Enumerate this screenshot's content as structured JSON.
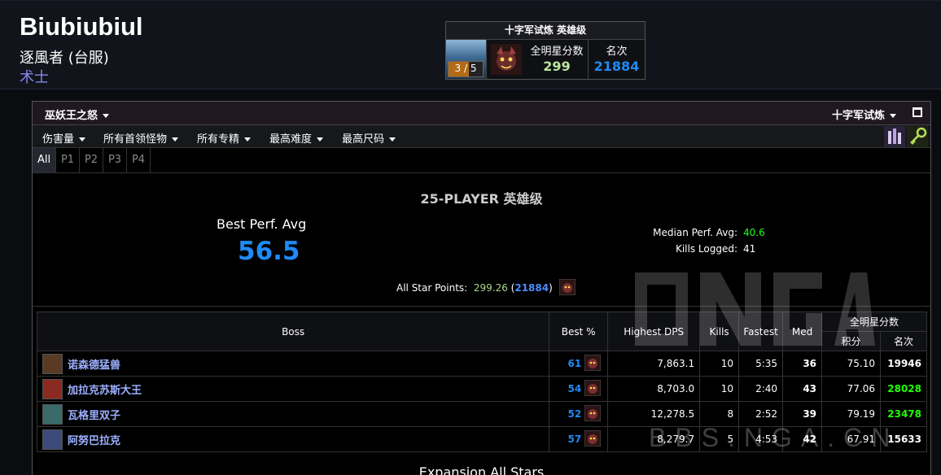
{
  "character": {
    "name": "Biubiubiul",
    "server": "逐風者 (台服)",
    "class": "术士"
  },
  "zone_box": {
    "title": "十字军试炼 英雄级",
    "progress_text": "3 / 5",
    "progress_fraction": 0.6,
    "points_label": "全明星分数",
    "points_value": "299",
    "rank_label": "名次",
    "rank_value": "21884"
  },
  "panel": {
    "zone_dropdown": "巫妖王之怒",
    "partition_dropdown": "十字军试炼",
    "filters": [
      "伤害量",
      "所有首领怪物",
      "所有专精",
      "最高难度",
      "最高尺码"
    ],
    "tabs": [
      "All",
      "P1",
      "P2",
      "P3",
      "P4"
    ],
    "active_tab": "All"
  },
  "summary": {
    "title": "25-PLAYER 英雄级",
    "best_perf_label": "Best Perf. Avg",
    "best_perf_value": "56.5",
    "median_label": "Median Perf. Avg:",
    "median_value": "40.6",
    "kills_label": "Kills Logged:",
    "kills_value": "41",
    "allstar_label": "All Star Points:",
    "allstar_points": "299.26",
    "allstar_rank": "21884"
  },
  "table": {
    "headers": {
      "boss": "Boss",
      "best": "Best %",
      "dps": "Highest DPS",
      "kills": "Kills",
      "fastest": "Fastest",
      "med": "Med",
      "allstar": "全明星分数",
      "points": "积分",
      "rank": "名次"
    },
    "rows": [
      {
        "boss": "诺森德猛兽",
        "best": "61",
        "dps": "7,863.1",
        "kills": "10",
        "fastest": "5:35",
        "med": "36",
        "points": "75.10",
        "rank": "19946"
      },
      {
        "boss": "加拉克苏斯大王",
        "best": "54",
        "dps": "8,703.0",
        "kills": "10",
        "fastest": "2:40",
        "med": "43",
        "points": "77.06",
        "rank": "28028"
      },
      {
        "boss": "瓦格里双子",
        "best": "52",
        "dps": "12,278.5",
        "kills": "8",
        "fastest": "2:52",
        "med": "39",
        "points": "79.19",
        "rank": "23478"
      },
      {
        "boss": "阿努巴拉克",
        "best": "57",
        "dps": "8,279.7",
        "kills": "5",
        "fastest": "4:53",
        "med": "42",
        "points": "67.91",
        "rank": "15633"
      }
    ]
  },
  "expansion_title": "Expansion All Stars",
  "watermark": "BBS.NGA.CN",
  "colors": {
    "best_blue": "#1f8af5",
    "med_green": "#1eff1e",
    "class_purple": "#8787ed"
  }
}
